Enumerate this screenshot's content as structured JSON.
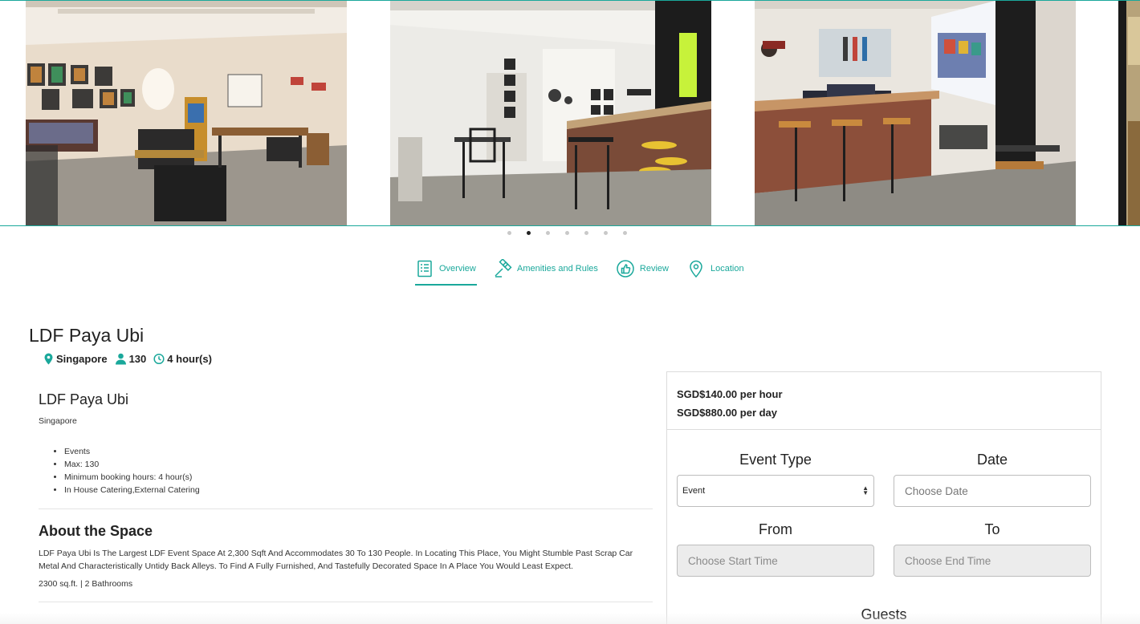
{
  "carousel": {
    "slides": [
      {
        "name": "lounge-room"
      },
      {
        "name": "bar-area"
      },
      {
        "name": "projector-lounge"
      },
      {
        "name": "partial-slide"
      }
    ],
    "dot_count": 7,
    "active_dot": 2
  },
  "tabs": [
    {
      "label": "Overview",
      "icon": "document-list-icon",
      "active": true
    },
    {
      "label": "Amenities and Rules",
      "icon": "gavel-icon",
      "active": false
    },
    {
      "label": "Review",
      "icon": "thumbs-up-icon",
      "active": false
    },
    {
      "label": "Location",
      "icon": "map-pin-icon",
      "active": false
    }
  ],
  "venue": {
    "title": "LDF Paya Ubi",
    "location": "Singapore",
    "capacity": "130",
    "min_hours": "4 hour(s)"
  },
  "overview": {
    "name": "LDF Paya Ubi",
    "location": "Singapore",
    "features": [
      "Events",
      "Max: 130",
      "Minimum booking hours: 4 hour(s)",
      "In House Catering,External Catering"
    ]
  },
  "about": {
    "heading": "About the Space",
    "description": "LDF Paya Ubi Is The Largest LDF Event Space At 2,300 Sqft And Accommodates 30 To 130 People. In Locating This Place, You Might Stumble Past Scrap Car Metal And Characteristically Untidy Back Alleys. To Find A Fully Furnished, And Tastefully Decorated Space In A Place You Would Least Expect.",
    "size": "2300 sq.ft. | 2 Bathrooms"
  },
  "booking": {
    "price_hour": "SGD$140.00 per hour",
    "price_day": "SGD$880.00 per day",
    "event_type_label": "Event Type",
    "event_type_value": "Event",
    "date_label": "Date",
    "date_placeholder": "Choose Date",
    "from_label": "From",
    "from_placeholder": "Choose Start Time",
    "to_label": "To",
    "to_placeholder": "Choose End Time",
    "guests_label": "Guests"
  },
  "colors": {
    "accent": "#1aa89b",
    "text": "#222222",
    "border": "#dcdcdc"
  }
}
